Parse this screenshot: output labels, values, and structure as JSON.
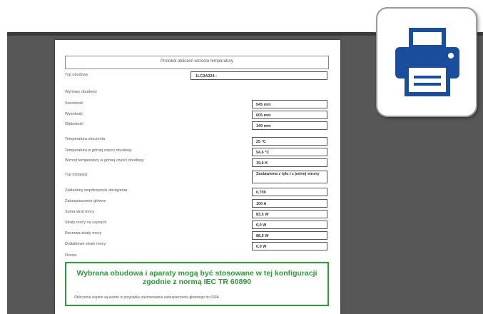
{
  "document": {
    "title": "Protokół obliczeń wzrostu temperatury",
    "rows": [
      {
        "label": "Typ obudowy",
        "value": "1LC3A324--"
      },
      {
        "label": "Wymiary obudowy",
        "value": ""
      },
      {
        "label": "Szerokość",
        "value": "545 mm"
      },
      {
        "label": "Wysokość",
        "value": "605 mm"
      },
      {
        "label": "Głębokość",
        "value": "140 mm"
      },
      {
        "label": "Temperatura otoczenia",
        "value": "25 °C"
      },
      {
        "label": "Temperatura w górnej części obudowy",
        "value": "54,6 °C"
      },
      {
        "label": "Wzrost temperatury w górnej części obudowy",
        "value": "19,6 K"
      },
      {
        "label": "Typ instalacji",
        "value": "Zastawiona z tyłu i z jednej strony"
      },
      {
        "label": "Zakładany współczynnik obciążenia",
        "value": "0,700"
      },
      {
        "label": "Zabezpieczenie główne",
        "value": "100 A"
      },
      {
        "label": "Suma strat mocy",
        "value": "83,5 W"
      },
      {
        "label": "Straty mocy na szynach",
        "value": "0,0 W"
      },
      {
        "label": "Rezerwa straty mocy",
        "value": "88,5 W"
      },
      {
        "label": "Dodatkowe straty mocy",
        "value": "0,0 W"
      },
      {
        "label": "Ocena",
        "value": ""
      }
    ],
    "conclusion_title": "Wybrana obudowa i aparaty mogą być stosowane w tej konfiguracji zgodnie z normą IEC TR 60890",
    "conclusion_note": "Obliczenia cieplne są ważne w przypadku zastosowania zabezpieczenia głównego do 630A"
  },
  "print_button": {
    "icon": "printer-icon",
    "color": "#1a4e9c"
  }
}
